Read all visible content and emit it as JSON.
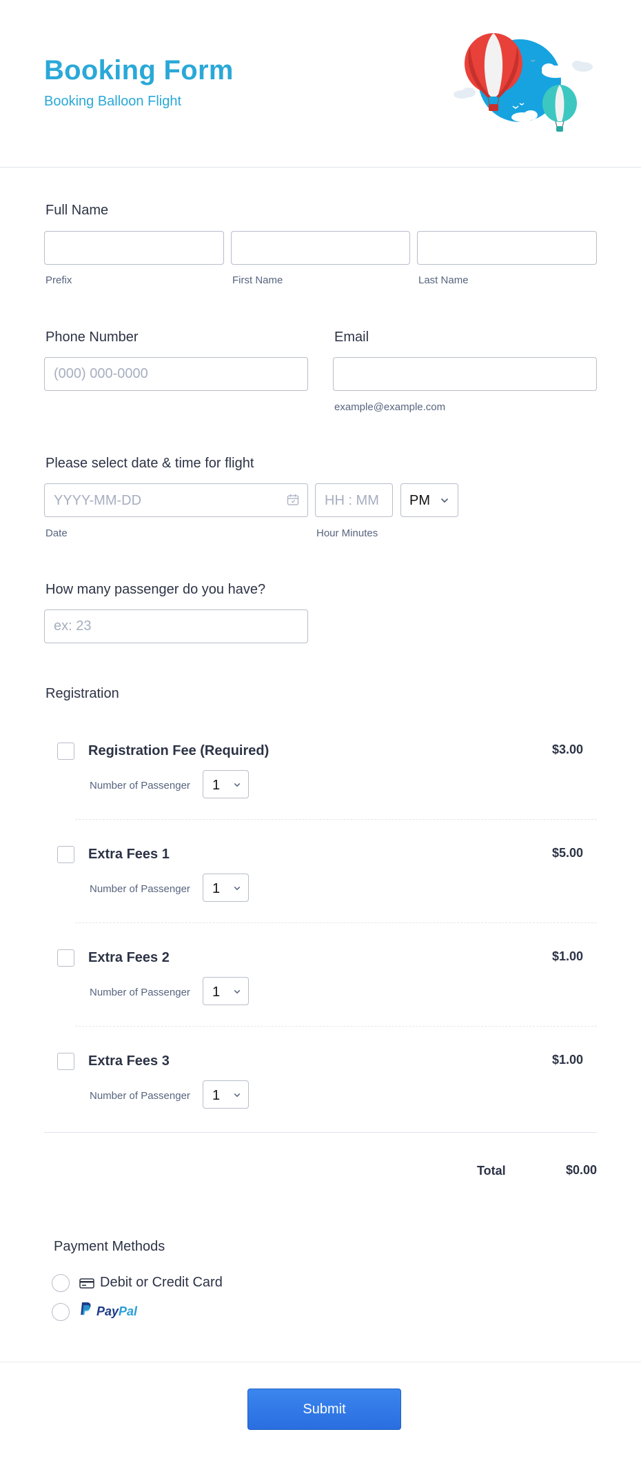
{
  "header": {
    "title": "Booking Form",
    "subtitle": "Booking Balloon Flight"
  },
  "full_name": {
    "label": "Full Name",
    "prefix_sublabel": "Prefix",
    "first_sublabel": "First Name",
    "last_sublabel": "Last Name",
    "prefix_value": "",
    "first_value": "",
    "last_value": ""
  },
  "phone": {
    "label": "Phone Number",
    "placeholder": "(000) 000-0000",
    "value": ""
  },
  "email": {
    "label": "Email",
    "sublabel": "example@example.com",
    "value": ""
  },
  "flight_datetime": {
    "label": "Please select date & time for flight",
    "date_placeholder": "YYYY-MM-DD",
    "date_sublabel": "Date",
    "time_placeholder": "HH : MM",
    "time_sublabel": "Hour Minutes",
    "ampm_selected": "PM",
    "calendar_icon": "calendar-icon"
  },
  "passengers": {
    "label": "How many passenger do you have?",
    "placeholder": "ex: 23",
    "value": ""
  },
  "registration": {
    "label": "Registration",
    "products": [
      {
        "name": "Registration Fee (Required)",
        "price": "$3.00",
        "qty_label": "Number of Passenger",
        "qty": "1"
      },
      {
        "name": "Extra Fees 1",
        "price": "$5.00",
        "qty_label": "Number of Passenger",
        "qty": "1"
      },
      {
        "name": "Extra Fees 2",
        "price": "$1.00",
        "qty_label": "Number of Passenger",
        "qty": "1"
      },
      {
        "name": "Extra Fees 3",
        "price": "$1.00",
        "qty_label": "Number of Passenger",
        "qty": "1"
      }
    ],
    "total_label": "Total",
    "total_value": "$0.00"
  },
  "payment": {
    "label": "Payment Methods",
    "options": [
      {
        "label": "Debit or Credit Card",
        "icon": "credit-card-icon"
      },
      {
        "label": "PayPal",
        "icon": "paypal-logo"
      }
    ]
  },
  "submit_label": "Submit",
  "colors": {
    "accent": "#2aa8d8",
    "submit": "#2f78e8",
    "text": "#2c3345",
    "border": "#b8bdc9"
  }
}
